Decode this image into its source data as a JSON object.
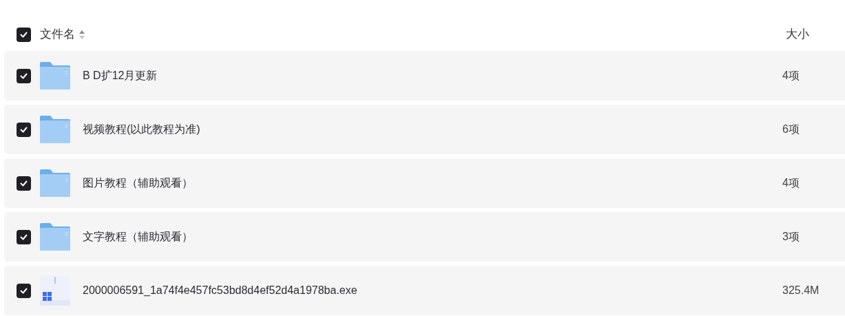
{
  "header": {
    "checked": true,
    "name_label": "文件名",
    "size_label": "大小"
  },
  "rows": [
    {
      "kind": "folder",
      "name": "B D扩12月更新",
      "size": "4项",
      "checked": true
    },
    {
      "kind": "folder",
      "name": "视频教程(以此教程为准)",
      "size": "6项",
      "checked": true
    },
    {
      "kind": "folder",
      "name": "图片教程（辅助观看）",
      "size": "4项",
      "checked": true
    },
    {
      "kind": "folder",
      "name": "文字教程（辅助观看）",
      "size": "3项",
      "checked": true
    },
    {
      "kind": "exe",
      "name": "2000006591_1a74f4e457fc53bd8d4ef52d4a1978ba.exe",
      "size": "325.4M",
      "checked": true
    }
  ]
}
